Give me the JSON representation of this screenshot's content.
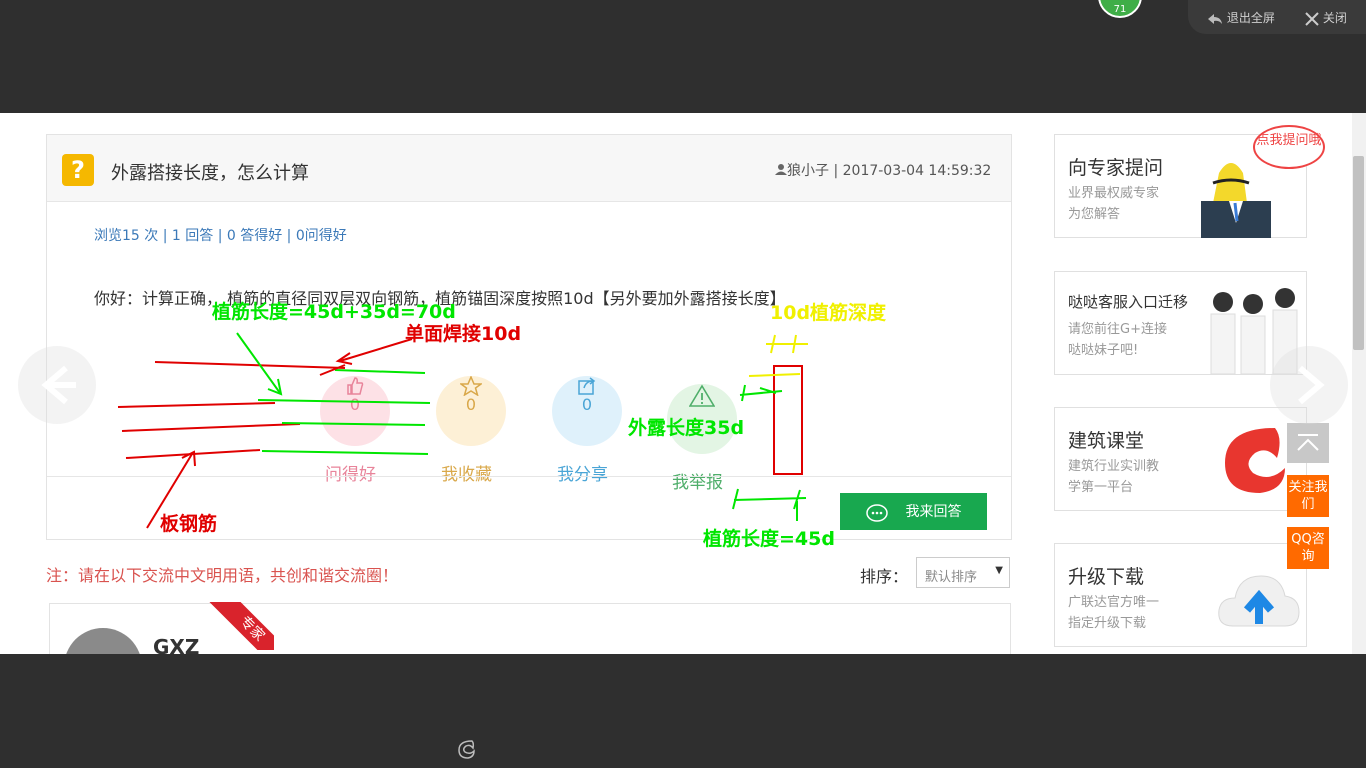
{
  "window": {
    "badge_count": "71",
    "exit_fullscreen_label": "退出全屏",
    "close_label": "关闭"
  },
  "question": {
    "title": "外露搭接长度，怎么计算",
    "author": "狼小子",
    "timestamp": "2017-03-04 14:59:32",
    "stats": "浏览15 次 | 1 回答 | 0 答得好 | 0问得好",
    "answer_text": "你好：计算正确，  植筋的直径同双层双向钢筋，植筋锚固深度按照10d【另外要加外露搭接长度】"
  },
  "actions": [
    {
      "label": "问得好",
      "count": "0",
      "icon": "thumbs-up-icon",
      "bg": "#fde1e6",
      "color": "#e8849a"
    },
    {
      "label": "我收藏",
      "count": "0",
      "icon": "star-icon",
      "bg": "#fdf0d6",
      "color": "#d9a84a"
    },
    {
      "label": "我分享",
      "count": "0",
      "icon": "share-icon",
      "bg": "#dff1fb",
      "color": "#4aa5d6"
    },
    {
      "label": "我举报",
      "count": "",
      "icon": "warning-icon",
      "bg": "#e3f5e4",
      "color": "#4fae6a"
    }
  ],
  "reply_button_label": "我来回答",
  "notice": "注：请在以下交流中文明用语，共创和谐交流圈！",
  "sort": {
    "label": "排序：",
    "selected": "默认排序"
  },
  "expert": {
    "name": "GXZ",
    "badge": "专家"
  },
  "sidebar": [
    {
      "title": "向专家提问",
      "subtitle1": "业界最权威专家",
      "subtitle2": "为您解答",
      "bubble": "点我提问哦"
    },
    {
      "title": "哒哒客服入口迁移",
      "subtitle1": "请您前往G+连接",
      "subtitle2": "哒哒妹子吧!"
    },
    {
      "title": "建筑课堂",
      "subtitle1": "建筑行业实训教",
      "subtitle2": "学第一平台"
    },
    {
      "title": "升级下载",
      "subtitle1": "广联达官方唯一",
      "subtitle2": "指定升级下载"
    }
  ],
  "floating": {
    "follow": "关注我们",
    "qq": "QQ咨询"
  },
  "annotations": {
    "green1": "植筋长度=45d+35d=70d",
    "red1": "单面焊接10d",
    "yellow1": "10d植筋深度",
    "green2": "外露长度35d",
    "red2": "板钢筋",
    "green3": "植筋长度=45d"
  },
  "colors": {
    "green": "#00e600",
    "red": "#e00000",
    "yellow": "#f0f000",
    "reply_green": "#18a84f",
    "orange": "#ff6a00"
  }
}
